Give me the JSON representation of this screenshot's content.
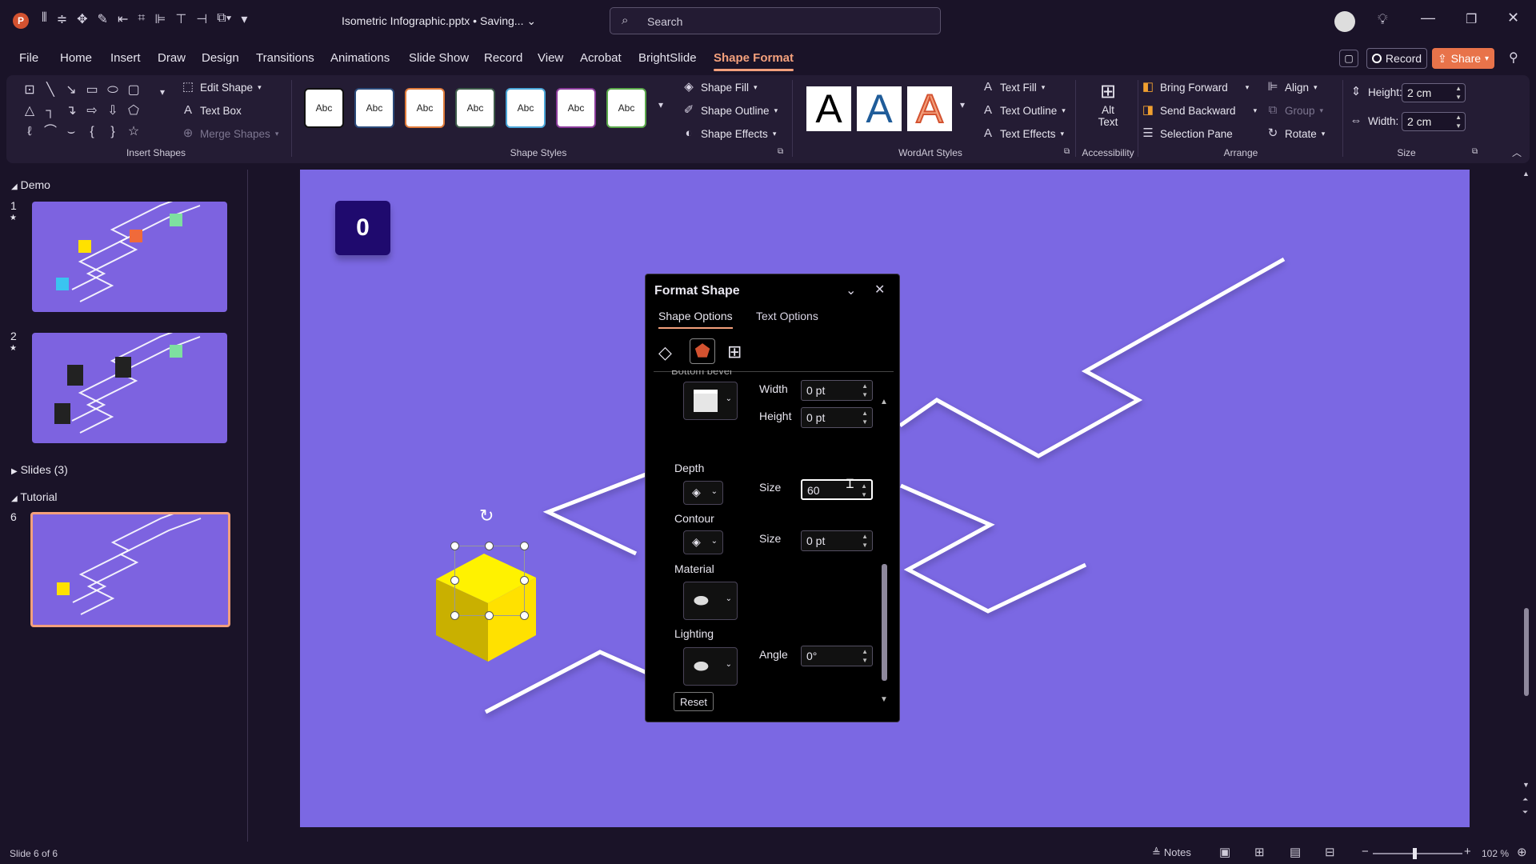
{
  "titlebar": {
    "doc_title": "Isometric Infographic.pptx • Saving...",
    "search_placeholder": "Search"
  },
  "tabs": [
    "File",
    "Home",
    "Insert",
    "Draw",
    "Design",
    "Transitions",
    "Animations",
    "Slide Show",
    "Record",
    "View",
    "Acrobat",
    "BrightSlide",
    "Shape Format"
  ],
  "active_tab": "Shape Format",
  "top_right": {
    "record": "Record",
    "share": "Share"
  },
  "ribbon": {
    "insert_shapes": {
      "label": "Insert Shapes",
      "edit_shape": "Edit Shape",
      "text_box": "Text Box",
      "merge_shapes": "Merge Shapes"
    },
    "shape_styles": {
      "label": "Shape Styles",
      "abc": "Abc",
      "shape_fill": "Shape Fill",
      "shape_outline": "Shape Outline",
      "shape_effects": "Shape Effects"
    },
    "wordart": {
      "label": "WordArt Styles",
      "letter": "A",
      "text_fill": "Text Fill",
      "text_outline": "Text Outline",
      "text_effects": "Text Effects"
    },
    "accessibility": {
      "label": "Accessibility",
      "alt": "Alt",
      "text": "Text"
    },
    "arrange": {
      "label": "Arrange",
      "bring_forward": "Bring Forward",
      "send_backward": "Send Backward",
      "selection_pane": "Selection Pane",
      "align": "Align",
      "group": "Group",
      "rotate": "Rotate"
    },
    "size": {
      "label": "Size",
      "height_label": "Height:",
      "height_value": "2 cm",
      "width_label": "Width:",
      "width_value": "2 cm"
    }
  },
  "slides_panel": {
    "section_demo": "Demo",
    "section_slides": "Slides (3)",
    "section_tutorial": "Tutorial",
    "num1": "1",
    "num2": "2",
    "num6": "6",
    "star": "★"
  },
  "slide": {
    "counter_value": "0"
  },
  "format_pane": {
    "title": "Format Shape",
    "tab_shape": "Shape Options",
    "tab_text": "Text Options",
    "bottom_bevel": "Bottom bevel",
    "width_label": "Width",
    "width_value": "0 pt",
    "height_label": "Height",
    "height_value": "0 pt",
    "depth_label": "Depth",
    "depth_size_label": "Size",
    "depth_size_value": "60",
    "contour_label": "Contour",
    "contour_size_label": "Size",
    "contour_size_value": "0 pt",
    "material_label": "Material",
    "lighting_label": "Lighting",
    "angle_label": "Angle",
    "angle_value": "0°",
    "reset": "Reset"
  },
  "status": {
    "slide_info": "Slide 6 of 6",
    "notes": "Notes",
    "zoom": "102 %"
  },
  "colors": {
    "accent": "#f3a07c",
    "slide_bg": "#7b68e3",
    "cube": "#ffe100",
    "counter_box": "#1f0a6e"
  }
}
